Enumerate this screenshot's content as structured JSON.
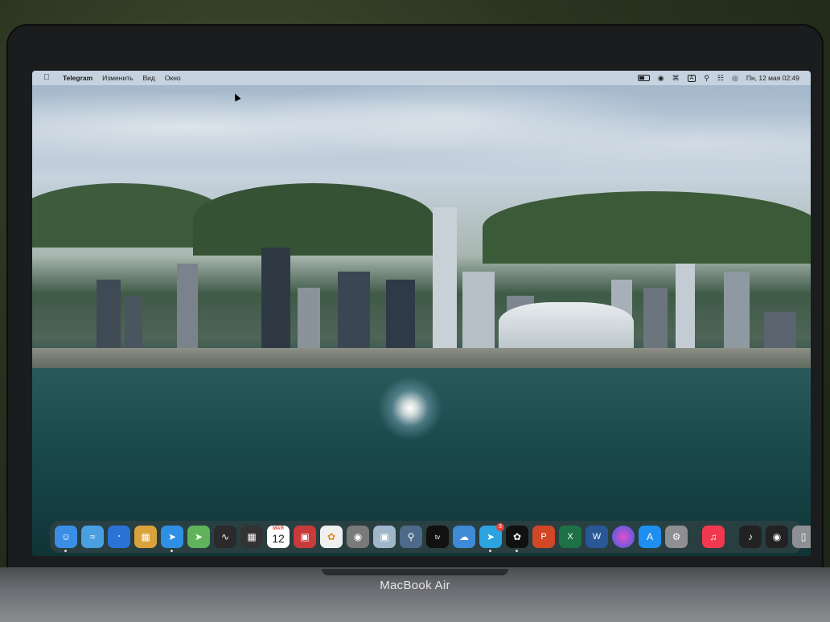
{
  "device": {
    "brand_label": "MacBook Air"
  },
  "menubar": {
    "app_name": "Telegram",
    "menus": [
      "Изменить",
      "Вид",
      "Окно"
    ],
    "datetime": "Пн, 12 мая  02:49",
    "input_source": "A"
  },
  "dock": {
    "items": [
      {
        "name": "finder",
        "color": "#3a8ee6"
      },
      {
        "name": "wifi",
        "color": "#4a9fe0"
      },
      {
        "name": "bluetooth",
        "color": "#2b72d6"
      },
      {
        "name": "launchpad",
        "color": "#d24b4b"
      },
      {
        "name": "safari",
        "color": "#2f8fe5"
      },
      {
        "name": "maps",
        "color": "#5fb35a"
      },
      {
        "name": "voice-memos",
        "color": "#2a2a2a"
      },
      {
        "name": "calculator",
        "color": "#333333"
      },
      {
        "name": "calendar",
        "color": "#ffffff"
      },
      {
        "name": "photo-booth",
        "color": "#c93a3a"
      },
      {
        "name": "photos",
        "color": "#f0f0f0"
      },
      {
        "name": "screenshot",
        "color": "#7a7a7a"
      },
      {
        "name": "preview",
        "color": "#9fb7c9"
      },
      {
        "name": "quicktime",
        "color": "#4d6a8a"
      },
      {
        "name": "apple-tv",
        "color": "#111111"
      },
      {
        "name": "weather",
        "color": "#3f8ad6"
      },
      {
        "name": "telegram",
        "color": "#2aa3df"
      },
      {
        "name": "chatgpt",
        "color": "#111111"
      },
      {
        "name": "powerpoint",
        "color": "#d24726"
      },
      {
        "name": "excel",
        "color": "#1e7145"
      },
      {
        "name": "word",
        "color": "#2b5797"
      },
      {
        "name": "siri",
        "color": "#5b3fd6"
      },
      {
        "name": "app-store",
        "color": "#1f8ef1"
      },
      {
        "name": "system-settings",
        "color": "#8e8e93"
      },
      {
        "name": "music",
        "color": "#f2384e"
      },
      {
        "name": "recent-app",
        "color": "#222222"
      },
      {
        "name": "recent-app-2",
        "color": "#222222"
      },
      {
        "name": "trash",
        "color": "#9a9a9a"
      }
    ],
    "calendar_month": "МАЯ",
    "calendar_day": "12",
    "telegram_badge": "3"
  }
}
